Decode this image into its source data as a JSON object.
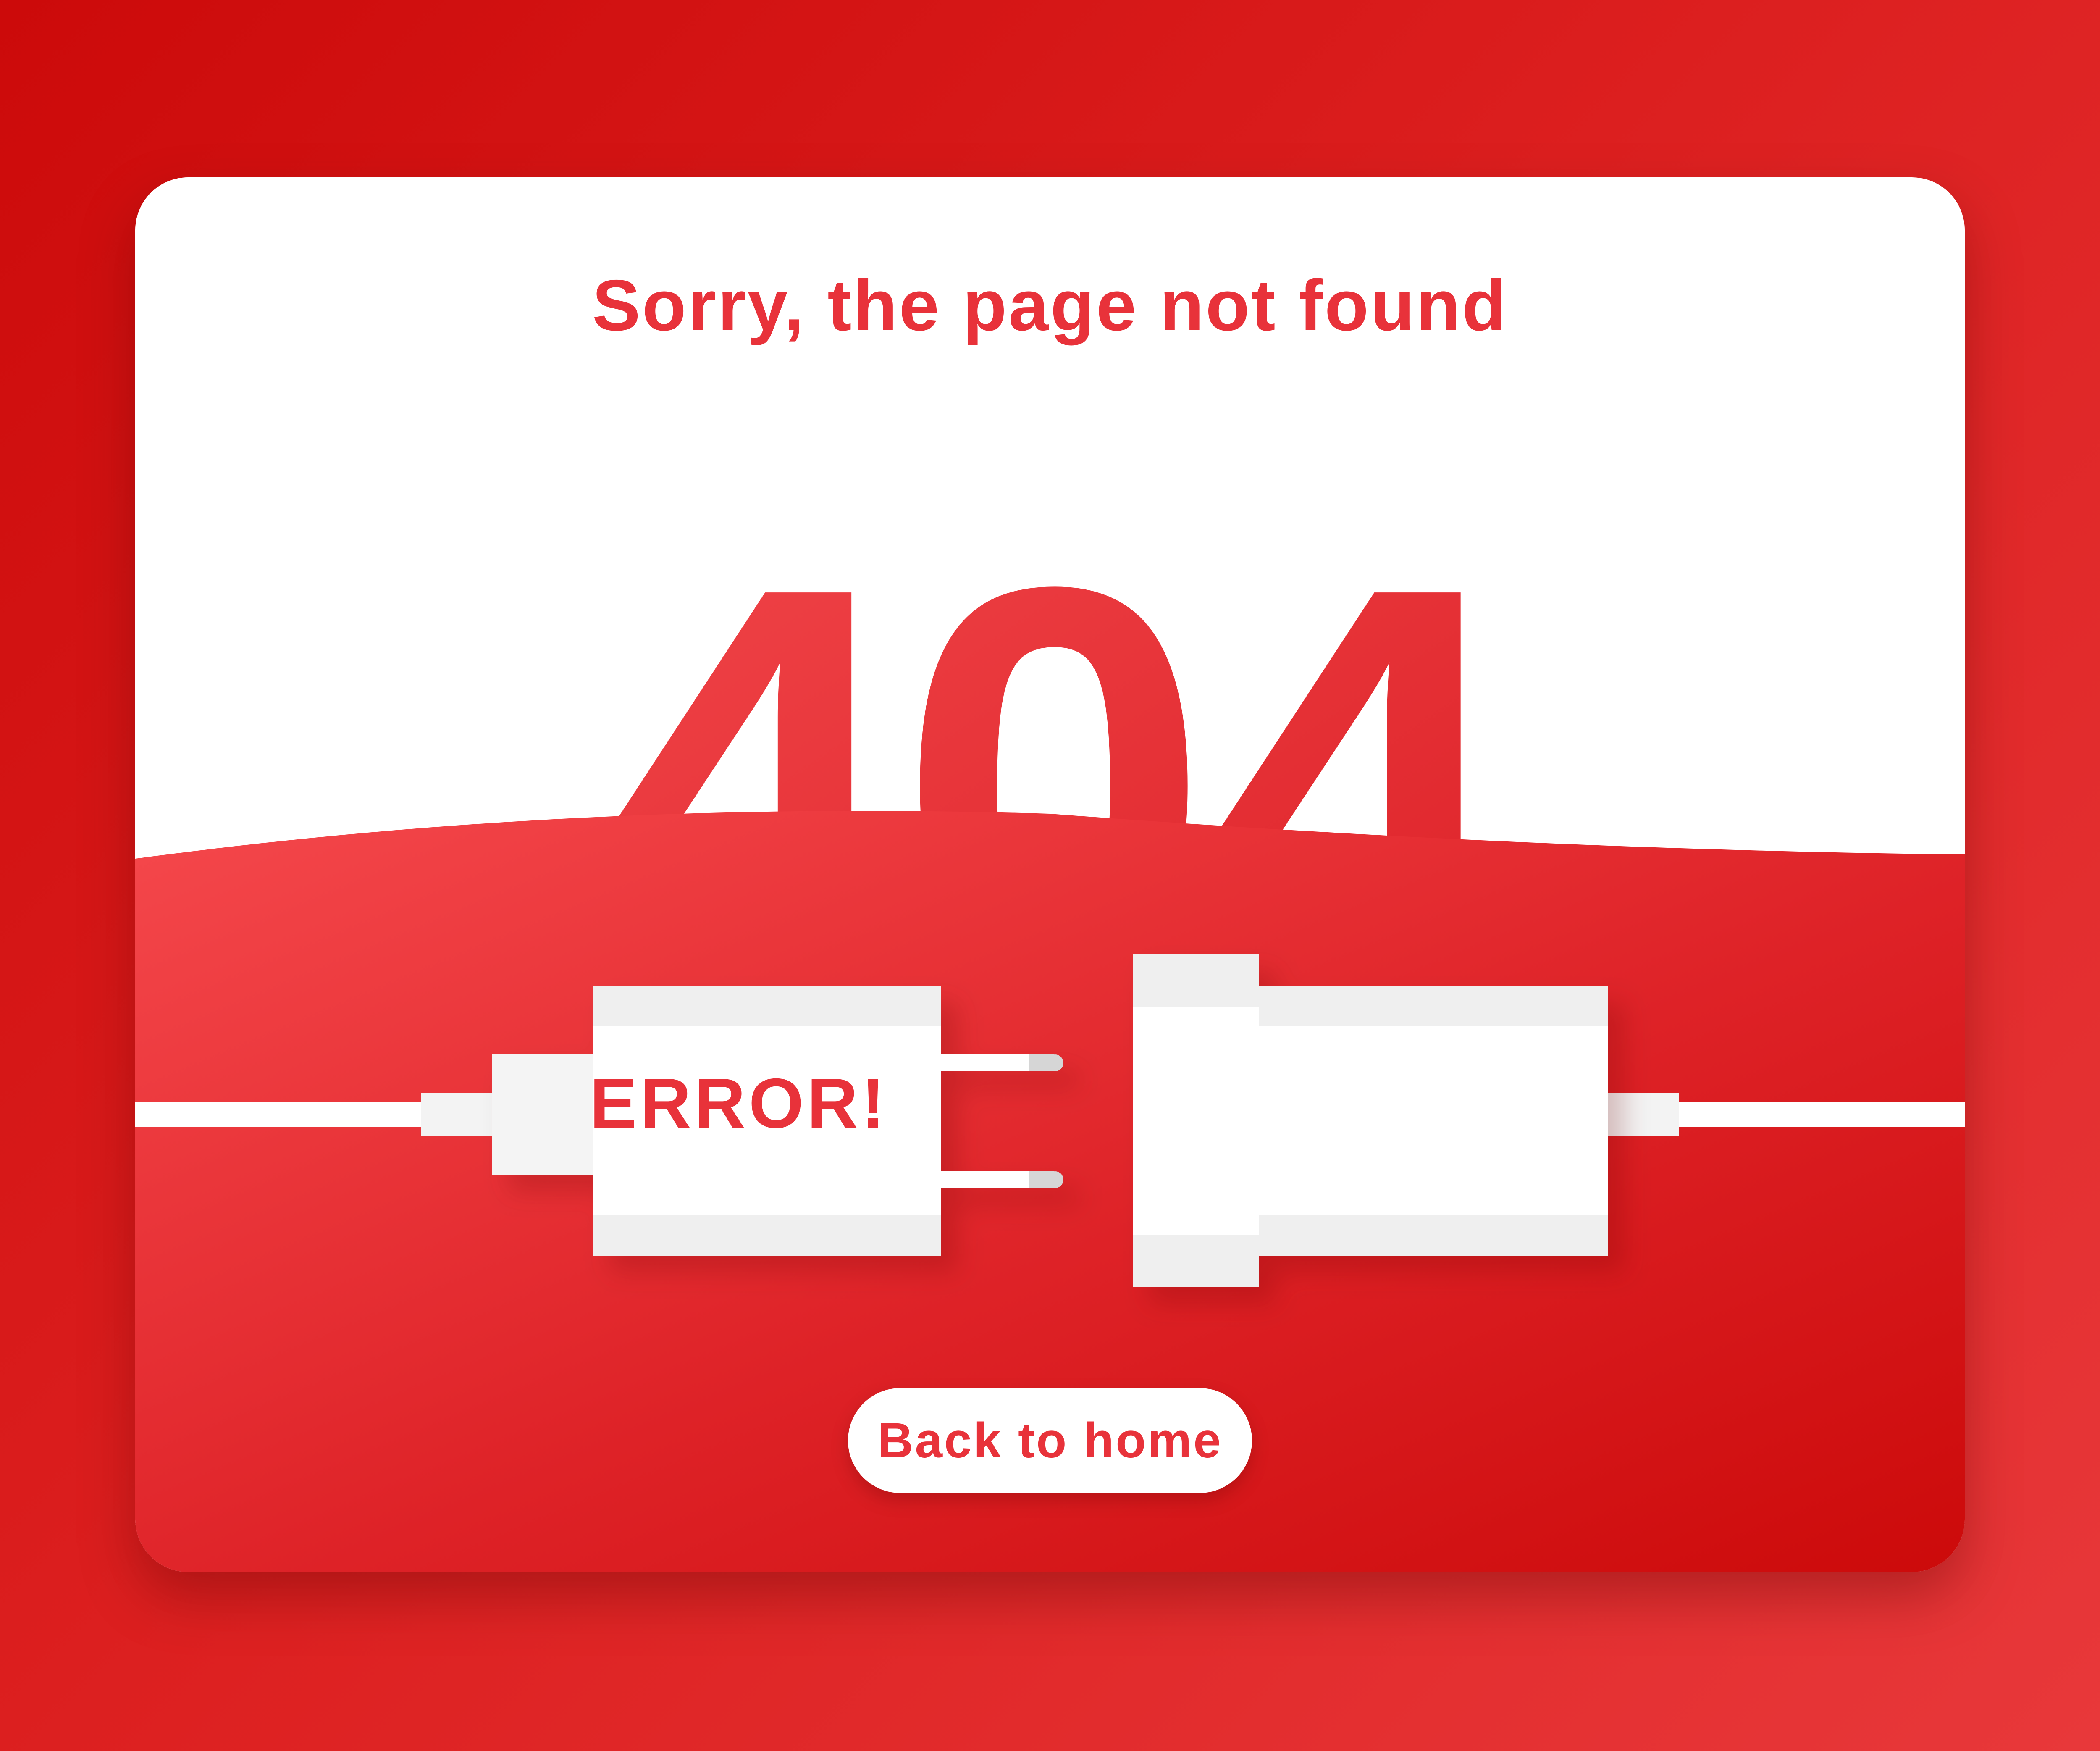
{
  "headline": "Sorry, the page not found",
  "error_code": "404",
  "plug_label": "ERROR!",
  "home_button_label": "Back to home",
  "colors": {
    "accent": "#e8323a",
    "background_dark": "#cc0a0a",
    "background_light": "#ef4448",
    "white": "#ffffff",
    "plug_shade": "#efefef"
  },
  "icons": {
    "left": "plug-icon",
    "right": "socket-icon"
  }
}
